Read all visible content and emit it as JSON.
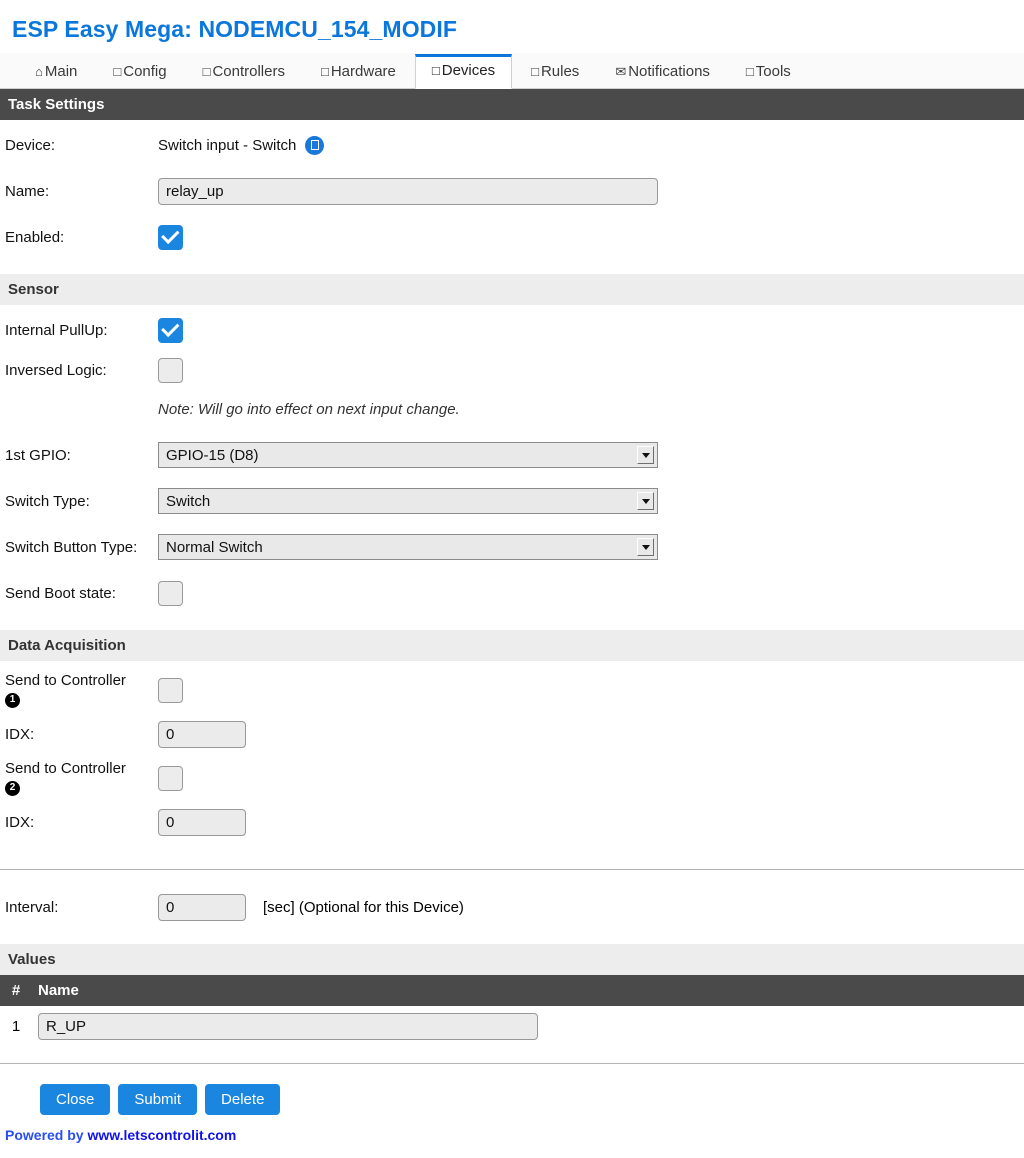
{
  "header": {
    "title": "ESP Easy Mega: NODEMCU_154_MODIF"
  },
  "tabs": [
    {
      "label": "Main",
      "icon": "home-icon",
      "glyph": "⌂",
      "active": false
    },
    {
      "label": "Config",
      "icon": "box-icon",
      "glyph": "□",
      "active": false
    },
    {
      "label": "Controllers",
      "icon": "box-icon",
      "glyph": "□",
      "active": false
    },
    {
      "label": "Hardware",
      "icon": "box-icon",
      "glyph": "□",
      "active": false
    },
    {
      "label": "Devices",
      "icon": "box-icon",
      "glyph": "□",
      "active": true
    },
    {
      "label": "Rules",
      "icon": "box-icon",
      "glyph": "□",
      "active": false
    },
    {
      "label": "Notifications",
      "icon": "envelope-icon",
      "glyph": "✉",
      "active": false
    },
    {
      "label": "Tools",
      "icon": "box-icon",
      "glyph": "□",
      "active": false
    }
  ],
  "task_settings": {
    "section_title": "Task Settings",
    "device_label": "Device:",
    "device_value": "Switch input - Switch",
    "name_label": "Name:",
    "name_value": "relay_up",
    "enabled_label": "Enabled:",
    "enabled_checked": true
  },
  "sensor": {
    "section_title": "Sensor",
    "internal_pullup_label": "Internal PullUp:",
    "internal_pullup_checked": true,
    "inversed_logic_label": "Inversed Logic:",
    "inversed_logic_checked": false,
    "note": "Note: Will go into effect on next input change.",
    "gpio_label": "1st GPIO:",
    "gpio_value": "GPIO-15 (D8)",
    "switch_type_label": "Switch Type:",
    "switch_type_value": "Switch",
    "switch_button_type_label": "Switch Button Type:",
    "switch_button_type_value": "Normal Switch",
    "send_boot_state_label": "Send Boot state:",
    "send_boot_state_checked": false
  },
  "data_acquisition": {
    "section_title": "Data Acquisition",
    "controllers": [
      {
        "label": "Send to Controller",
        "number": "1",
        "checked": false,
        "idx_label": "IDX:",
        "idx_value": "0"
      },
      {
        "label": "Send to Controller",
        "number": "2",
        "checked": false,
        "idx_label": "IDX:",
        "idx_value": "0"
      }
    ],
    "interval_label": "Interval:",
    "interval_value": "0",
    "interval_suffix": "[sec] (Optional for this Device)"
  },
  "values": {
    "section_title": "Values",
    "columns": {
      "num": "#",
      "name": "Name"
    },
    "rows": [
      {
        "num": "1",
        "name": "R_UP"
      }
    ]
  },
  "buttons": {
    "close": "Close",
    "submit": "Submit",
    "delete": "Delete"
  },
  "footer": {
    "powered_by": "Powered by ",
    "link": "www.letscontrolit.com"
  },
  "colors": {
    "accent_blue": "#1a86e0",
    "title_blue": "#0b77dd",
    "dark_bar": "#4a4a4a",
    "light_bar": "#ededed",
    "input_bg": "#ebebeb",
    "link_blue": "#1111ee"
  }
}
